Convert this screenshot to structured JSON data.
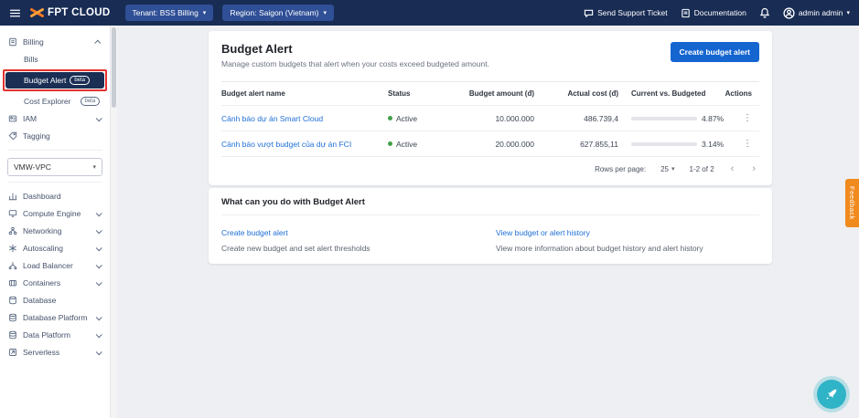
{
  "topbar": {
    "logo_text": "FPT CLOUD",
    "tenant_label": "Tenant: BSS Billing",
    "region_label": "Region: Saigon (Vietnam)",
    "support_label": "Send Support Ticket",
    "docs_label": "Documentation",
    "user_label": "admin admin"
  },
  "sidebar": {
    "billing": {
      "label": "Billing",
      "icon": "billing-icon"
    },
    "billing_children": [
      {
        "label": "Bills"
      },
      {
        "label": "Budget Alert",
        "badge": "beta",
        "selected": true
      },
      {
        "label": "Cost Explorer",
        "badge": "beta"
      }
    ],
    "iam": {
      "label": "IAM",
      "icon": "iam-icon"
    },
    "tagging": {
      "label": "Tagging",
      "icon": "tagging-icon"
    },
    "vpc_select": "VMW-VPC",
    "menu": [
      {
        "label": "Dashboard",
        "icon": "dashboard-icon",
        "chevron": false
      },
      {
        "label": "Compute Engine",
        "icon": "compute-engine-icon",
        "chevron": true
      },
      {
        "label": "Networking",
        "icon": "networking-icon",
        "chevron": true
      },
      {
        "label": "Autoscaling",
        "icon": "autoscaling-icon",
        "chevron": true
      },
      {
        "label": "Load Balancer",
        "icon": "load-balancer-icon",
        "chevron": true
      },
      {
        "label": "Containers",
        "icon": "containers-icon",
        "chevron": true
      },
      {
        "label": "Database",
        "icon": "database-icon",
        "chevron": false
      },
      {
        "label": "Database Platform",
        "icon": "database-platform-icon",
        "chevron": true
      },
      {
        "label": "Data Platform",
        "icon": "data-platform-icon",
        "chevron": true
      },
      {
        "label": "Serverless",
        "icon": "serverless-icon",
        "chevron": true
      }
    ]
  },
  "main": {
    "title": "Budget Alert",
    "subtitle": "Manage custom budgets that alert when your costs exceed budgeted amount.",
    "create_button": "Create budget alert",
    "table": {
      "headers": {
        "name": "Budget alert name",
        "status": "Status",
        "budget": "Budget amount (đ)",
        "actual": "Actual cost (đ)",
        "current": "Current vs. Budgeted",
        "actions": "Actions"
      },
      "rows": [
        {
          "name": "Cảnh báo dự án Smart Cloud",
          "status": "Active",
          "budget": "10.000.000",
          "actual": "486.739,4",
          "percent": "4.87%",
          "percent_value": 4.87
        },
        {
          "name": "Cảnh báo vượt budget của dự án FCI",
          "status": "Active",
          "budget": "20.000.000",
          "actual": "627.855,11",
          "percent": "3.14%",
          "percent_value": 3.14
        }
      ]
    },
    "pagination": {
      "rows_per_page_label": "Rows per page:",
      "rows_per_page": "25",
      "range": "1-2 of 2",
      "prev": "‹",
      "next": "›"
    },
    "help": {
      "title": "What can you do with Budget Alert",
      "links": [
        {
          "label": "Create budget alert",
          "desc": "Create new budget and set alert thresholds"
        },
        {
          "label": "View budget or alert history",
          "desc": "View more information about budget history and alert history"
        }
      ]
    }
  },
  "widgets": {
    "feedback_label": "Feedback"
  },
  "colors": {
    "topbar_bg": "#182c54",
    "accent_blue": "#1565d0",
    "link_blue": "#1f6fd6",
    "selected_bg": "#1b2f55",
    "status_green": "#43a047",
    "feedback_orange": "#f08a1d",
    "chat_teal": "#2fb3c7",
    "annotation_red": "#e5322d"
  }
}
